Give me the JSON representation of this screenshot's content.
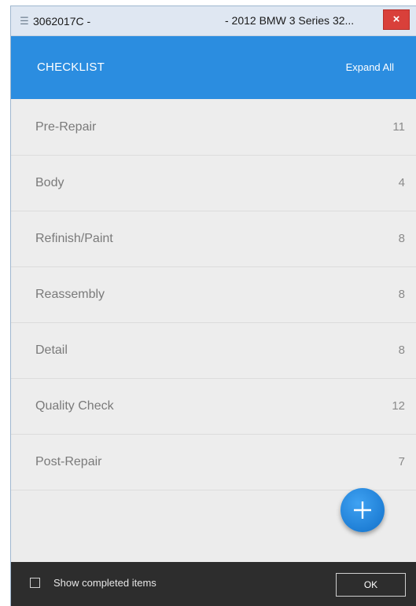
{
  "window": {
    "title_left": "3062017C -",
    "title_right": "- 2012 BMW 3 Series 32...",
    "close_glyph": "×"
  },
  "header": {
    "title": "CHECKLIST",
    "expand_all_label": "Expand All"
  },
  "checklist": {
    "items": [
      {
        "label": "Pre-Repair",
        "count": "11"
      },
      {
        "label": "Body",
        "count": "4"
      },
      {
        "label": "Refinish/Paint",
        "count": "8"
      },
      {
        "label": "Reassembly",
        "count": "8"
      },
      {
        "label": "Detail",
        "count": "8"
      },
      {
        "label": "Quality Check",
        "count": "12"
      },
      {
        "label": "Post-Repair",
        "count": "7"
      }
    ]
  },
  "footer": {
    "show_completed_label": "Show completed items",
    "ok_label": "OK"
  },
  "colors": {
    "accent": "#2b8de0",
    "close": "#d9403a",
    "footer": "#2d2d2d"
  }
}
